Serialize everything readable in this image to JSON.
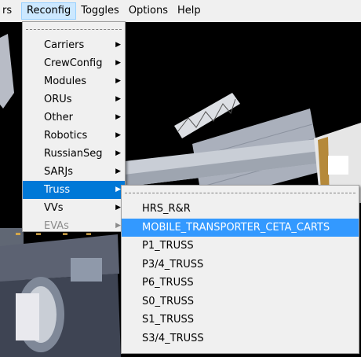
{
  "menubar": {
    "items": [
      {
        "label": "rs"
      },
      {
        "label": "Reconfig"
      },
      {
        "label": "Toggles"
      },
      {
        "label": "Options"
      },
      {
        "label": "Help"
      }
    ]
  },
  "reconfig_menu": {
    "items": [
      {
        "label": "Carriers",
        "submenu": true,
        "enabled": true
      },
      {
        "label": "CrewConfig",
        "submenu": true,
        "enabled": true
      },
      {
        "label": "Modules",
        "submenu": true,
        "enabled": true
      },
      {
        "label": "ORUs",
        "submenu": true,
        "enabled": true
      },
      {
        "label": "Other",
        "submenu": true,
        "enabled": true
      },
      {
        "label": "Robotics",
        "submenu": true,
        "enabled": true
      },
      {
        "label": "RussianSeg",
        "submenu": true,
        "enabled": true
      },
      {
        "label": "SARJs",
        "submenu": true,
        "enabled": true
      },
      {
        "label": "Truss",
        "submenu": true,
        "enabled": true,
        "selected": true
      },
      {
        "label": "VVs",
        "submenu": true,
        "enabled": true
      },
      {
        "label": "EVAs",
        "submenu": true,
        "enabled": false
      }
    ]
  },
  "truss_menu": {
    "items": [
      {
        "label": "HRS_R&R"
      },
      {
        "label": "MOBILE_TRANSPORTER_CETA_CARTS",
        "highlighted": true
      },
      {
        "label": "P1_TRUSS"
      },
      {
        "label": "P3/4_TRUSS"
      },
      {
        "label": "P6_TRUSS"
      },
      {
        "label": "S0_TRUSS"
      },
      {
        "label": "S1_TRUSS"
      },
      {
        "label": "S3/4_TRUSS"
      }
    ]
  },
  "colors": {
    "menu_bg": "#f0f0f0",
    "highlight": "#0078d7",
    "disabled_text": "#8c8c8c"
  },
  "icons": {
    "submenu_arrow": "▶"
  }
}
